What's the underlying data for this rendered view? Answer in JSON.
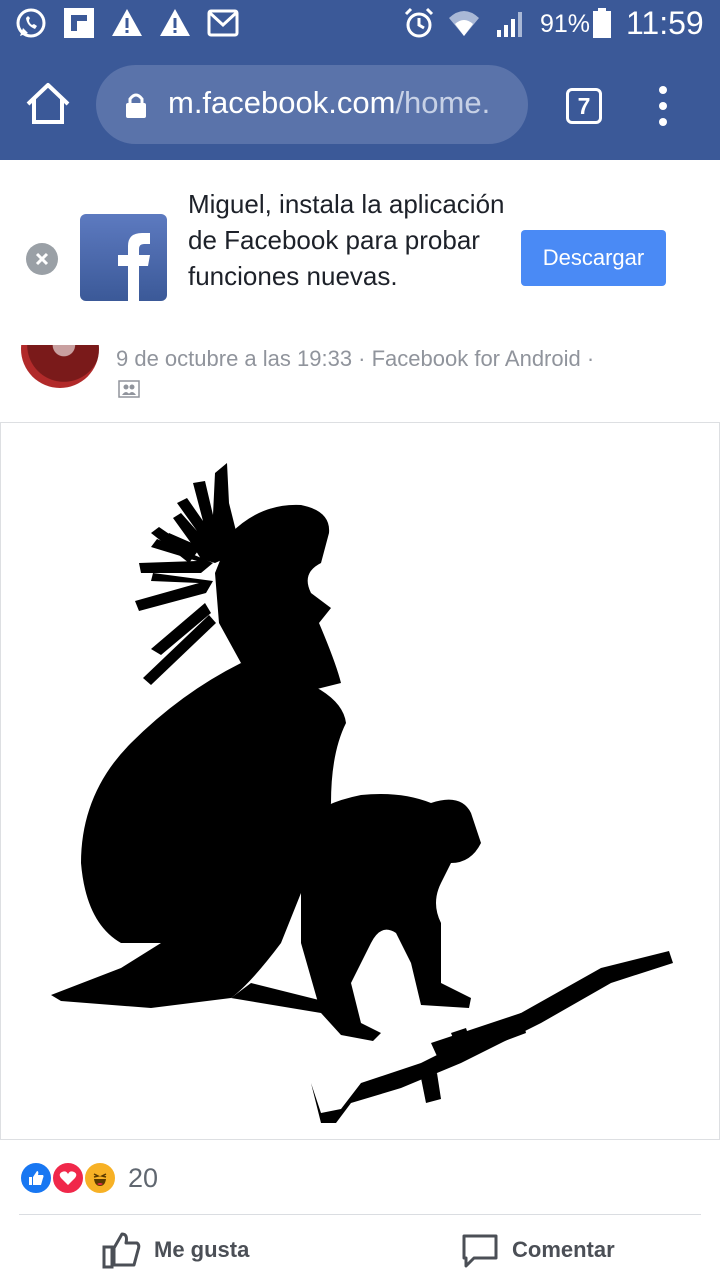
{
  "status_bar": {
    "left_icons": [
      "whatsapp-icon",
      "flipboard-icon",
      "warning-icon",
      "warning-icon",
      "gmail-icon"
    ],
    "right_icons": [
      "alarm-icon",
      "wifi-icon",
      "signal-icon",
      "battery-icon"
    ],
    "battery": "91%",
    "time": "11:59"
  },
  "browser": {
    "url_domain": "m.facebook.com",
    "url_path": "/home.",
    "tab_count": "7"
  },
  "install_banner": {
    "message": "Miguel, instala la aplicación de Facebook para probar funciones nuevas.",
    "button_label": "Descargar"
  },
  "post": {
    "meta": "9 de octubre a las 19:33 · Facebook for Android ·",
    "audience_icon": "friends-icon",
    "reaction_icons": [
      "like-reaction-icon",
      "love-reaction-icon",
      "haha-reaction-icon"
    ],
    "reaction_count": "20",
    "actions": {
      "like_label": "Me gusta",
      "comment_label": "Comentar"
    }
  },
  "colors": {
    "facebook_blue": "#3b5998",
    "download_button": "#4a8af5",
    "like_blue": "#1877f2",
    "love_red": "#f0284a",
    "haha_yellow": "#f7b125"
  }
}
